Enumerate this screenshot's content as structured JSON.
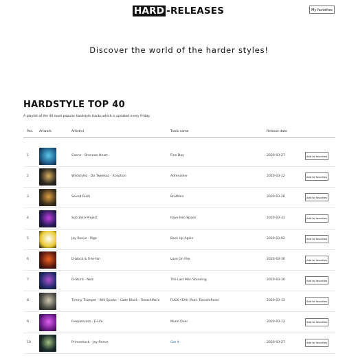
{
  "header": {
    "logo_box": "HARD",
    "logo_rest": "-RELEASES",
    "favorites_button": "My favorites"
  },
  "hero": {
    "tagline": "Discover the world of the harder styles!"
  },
  "section": {
    "title": "HARDSTYLE TOP 40",
    "description": "A playlist of the 40 most popular hardstyle tracks which is updated every Friday."
  },
  "table": {
    "columns": [
      "Pos.",
      "Artwork",
      "Artist(s)",
      "Track name",
      "Release date"
    ],
    "add_label": "Add to favorites",
    "rows": [
      {
        "pos": "1",
        "artists": "Coone - Brennan Heart",
        "track": "Fine Day",
        "date": "2020-03-27",
        "artwork_color": "#1e5a8a",
        "artwork_accent": "#58c8e8"
      },
      {
        "pos": "2",
        "artists": "Wildstylez - Da Tweekaz - Xception",
        "track": "Adrenaline",
        "date": "2020-03-12",
        "artwork_color": "#2a2620",
        "artwork_accent": "#d8b060"
      },
      {
        "pos": "3",
        "artists": "Sound Rush",
        "track": "Brothers",
        "date": "2020-03-26",
        "artwork_color": "#3a2f1c",
        "artwork_accent": "#e0a040"
      },
      {
        "pos": "4",
        "artists": "Sub Zero Project",
        "track": "Rave Into Space",
        "date": "2020-03-31",
        "artwork_color": "#2a1a5a",
        "artwork_accent": "#c040e0"
      },
      {
        "pos": "5",
        "artists": "Jay Reeve - Pigo",
        "track": "Back Up Again",
        "date": "2020-03-02",
        "artwork_color": "#e8c830",
        "artwork_accent": "#ffffff"
      },
      {
        "pos": "6",
        "artists": "D-block & S-te-fan",
        "track": "Love On Fire",
        "date": "2020-03-30",
        "artwork_color": "#5a1a10",
        "artwork_accent": "#f06020"
      },
      {
        "pos": "7",
        "artists": "D-Sturb - Nolz",
        "track": "The Last Man Standing",
        "date": "2020-03-30",
        "artwork_color": "#202a6a",
        "artwork_accent": "#b050d0"
      },
      {
        "pos": "8",
        "artists": "Timmy Trumpet - Will Sparks - Code Black - Toneshifterz",
        "track": "FUCK YEAH (feat. Toneshifterz)",
        "date": "2020-03-13",
        "artwork_color": "#4a4a44",
        "artwork_accent": "#d0c8b0"
      },
      {
        "pos": "9",
        "artists": "Frequencerz - E-Life",
        "track": "Munn Over",
        "date": "2020-03-13",
        "artwork_color": "#6a1a8a",
        "artwork_accent": "#e060f0"
      },
      {
        "pos": "10",
        "artists": "Primeshock - Jay Reeve",
        "track": "Get It",
        "date": "2020-03-27",
        "artwork_color": "#1a2a2a",
        "artwork_accent": "#a0c080"
      }
    ]
  }
}
